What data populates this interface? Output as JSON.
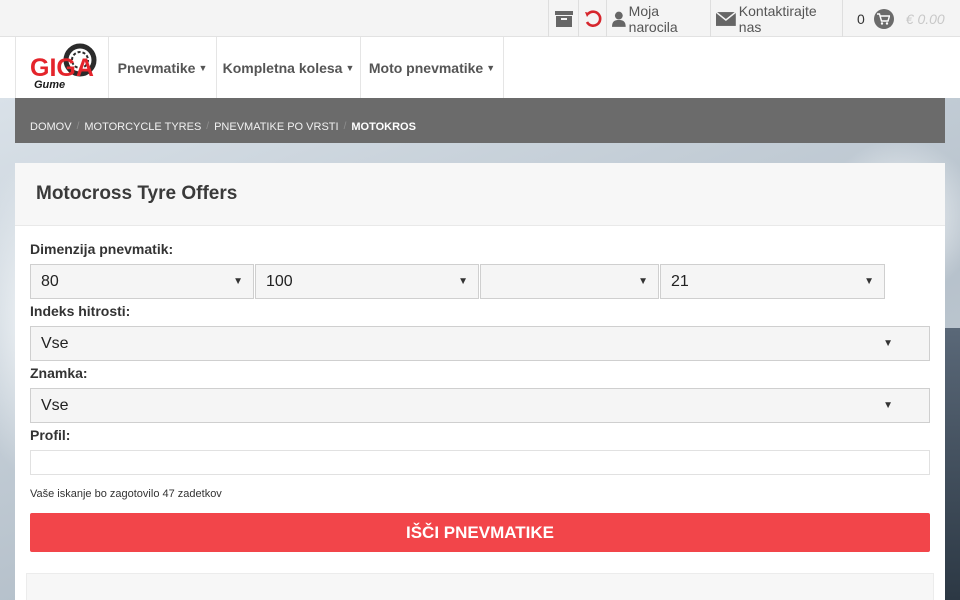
{
  "topbar": {
    "orders_label": "Moja narocila",
    "contact_label": "Kontaktirajte nas",
    "cart_count": "0",
    "cart_total": "€ 0.00"
  },
  "logo": {
    "main_text": "GIGA",
    "sub_text": "Gume",
    "accent_color": "#e4242b"
  },
  "nav": {
    "items": [
      {
        "label": "Pnevmatike"
      },
      {
        "label": "Kompletna kolesa"
      },
      {
        "label": "Moto pnevmatike"
      }
    ]
  },
  "breadcrumb": {
    "items": [
      "DOMOV",
      "MOTORCYCLE TYRES",
      "PNEVMATIKE PO VRSTI"
    ],
    "current": "MOTOKROS",
    "separator": "/"
  },
  "form": {
    "title": "Motocross Tyre Offers",
    "dimension_label": "Dimenzija pnevmatik:",
    "width_value": "80",
    "profile_value": "100",
    "construction_value": "",
    "rim_value": "21",
    "speed_label": "Indeks hitrosti:",
    "speed_value": "Vse",
    "brand_label": "Znamka:",
    "brand_value": "Vse",
    "profil_label": "Profil:",
    "result_note": "Vaše iskanje bo zagotovilo 47 zadetkov",
    "search_button": "IŠČI PNEVMATIKE",
    "button_color": "#f2454a"
  }
}
